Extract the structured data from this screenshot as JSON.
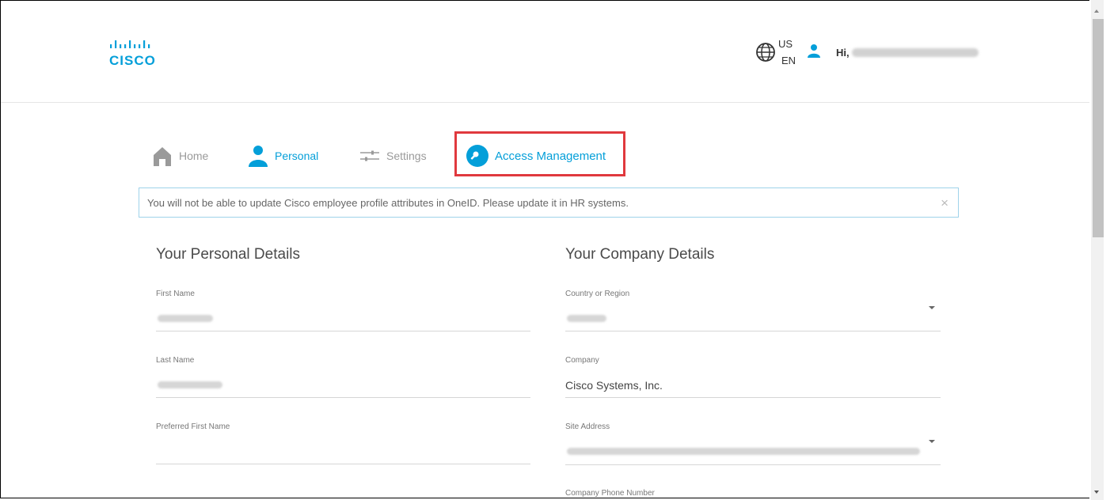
{
  "header": {
    "logo_text": "CISCO",
    "lang_country": "US",
    "lang_code": "EN",
    "greeting": "Hi,"
  },
  "nav": {
    "home": "Home",
    "personal": "Personal",
    "settings": "Settings",
    "access_management": "Access Management"
  },
  "banner": {
    "message": "You will not be able to update Cisco employee profile attributes in OneID. Please update it in HR systems.",
    "close": "×"
  },
  "personal": {
    "title": "Your Personal Details",
    "first_name_label": "First Name",
    "last_name_label": "Last Name",
    "preferred_first_name_label": "Preferred First Name"
  },
  "company": {
    "title": "Your Company Details",
    "country_label": "Country or Region",
    "company_label": "Company",
    "company_value": "Cisco Systems, Inc.",
    "site_address_label": "Site Address",
    "phone_label": "Company Phone Number"
  },
  "colors": {
    "brand": "#049fd9",
    "highlight": "#e0393e"
  }
}
